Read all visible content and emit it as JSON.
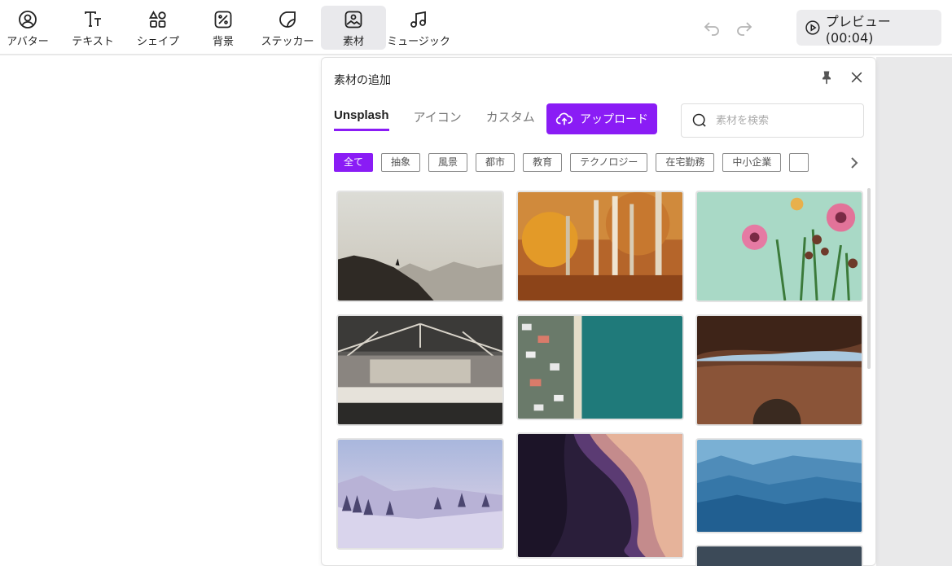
{
  "toolbar": {
    "tools": [
      {
        "label": "アバター",
        "icon": "avatar-icon"
      },
      {
        "label": "テキスト",
        "icon": "text-icon"
      },
      {
        "label": "シェイプ",
        "icon": "shapes-icon"
      },
      {
        "label": "背景",
        "icon": "background-icon"
      },
      {
        "label": "ステッカー",
        "icon": "sticker-icon"
      },
      {
        "label": "素材",
        "icon": "image-icon"
      },
      {
        "label": "ミュージック",
        "icon": "music-icon"
      }
    ],
    "active_tool": "素材",
    "undo_icon": "undo-icon",
    "redo_icon": "redo-icon",
    "preview_label": "プレビュー (00:04)"
  },
  "panel": {
    "title": "素材の追加",
    "tabs": [
      "Unsplash",
      "アイコン",
      "カスタム"
    ],
    "active_tab": "Unsplash",
    "upload_label": "アップロード",
    "search_placeholder": "素材を検索",
    "categories": [
      "全て",
      "抽象",
      "風景",
      "都市",
      "教育",
      "テクノロジー",
      "在宅勤務",
      "中小企業",
      ""
    ],
    "active_category": "全て",
    "images": [
      {
        "name": "mountain-hiker-image"
      },
      {
        "name": "autumn-forest-image"
      },
      {
        "name": "pink-flowers-image"
      },
      {
        "name": "train-station-image"
      },
      {
        "name": "aerial-beach-image"
      },
      {
        "name": "canyon-rock-image"
      },
      {
        "name": "snowy-trees-image"
      },
      {
        "name": "antelope-canyon-image"
      },
      {
        "name": "blue-mountains-image"
      },
      {
        "name": "partial-image"
      }
    ]
  },
  "colors": {
    "accent": "#8a1cf5",
    "toolbar_active_bg": "#e9e9ec",
    "preview_bg": "#ececee"
  }
}
